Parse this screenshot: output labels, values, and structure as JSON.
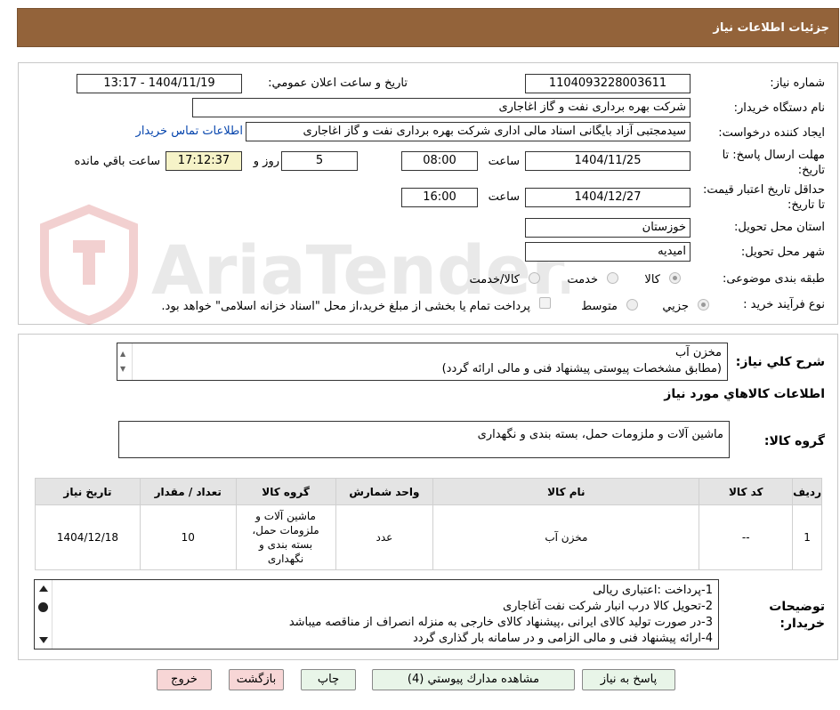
{
  "header": {
    "title": "جزئیات اطلاعات نیاز"
  },
  "watermark": {
    "text": "AriaTender.neT"
  },
  "form": {
    "need_number_label": "شماره نیاز:",
    "need_number": "1104093228003611",
    "announce_label": "تاریخ و ساعت اعلان عمومي:",
    "announce_value": "1404/11/19 - 13:17",
    "buyer_org_label": "نام دستگاه خريدار:",
    "buyer_org": "شرکت بهره برداری نفت و گاز اغاجاری",
    "requester_label": "ايجاد کننده درخواست:",
    "requester": "سیدمجتبی آزاد بایگانی اسناد مالی اداری شرکت بهره برداری نفت و گاز اغاجاری",
    "contact_link": "اطلاعات تماس خريدار",
    "deadline_label": "مهلت ارسال پاسخ: تا تاریخ:",
    "deadline_date": "1404/11/25",
    "time_label": "ساعت",
    "deadline_time": "08:00",
    "days_value": "5",
    "days_label": "روز و",
    "remaining_time": "17:12:37",
    "remaining_label": "ساعت باقي مانده",
    "validity_label": "حداقل تاريخ اعتبار قيمت: تا تاریخ:",
    "validity_date": "1404/12/27",
    "validity_time": "16:00",
    "province_label": "استان محل تحويل:",
    "province": "خوزستان",
    "city_label": "شهر محل تحويل:",
    "city": "امیدیه",
    "category_label": "طبقه بندی موضوعی:",
    "category_options": [
      "کالا",
      "خدمت",
      "کالا/خدمت"
    ],
    "process_label": "نوع فرآیند خرید :",
    "process_options": [
      "جزیي",
      "متوسط"
    ],
    "process_note": "پرداخت تمام يا بخشی از مبلغ خريد،از محل \"اسناد خزانه اسلامی\" خواهد بود."
  },
  "description": {
    "label": "شرح كلي نياز:",
    "line1": "مخزن آب",
    "line2": "(مطابق مشخصات پیوستی پیشنهاد فنی و مالی ارائه گردد)"
  },
  "goods": {
    "section_title": "اطلاعات كالاهاي مورد نياز",
    "group_label": "گروه كالا:",
    "group_value": "ماشین آلات و ملزومات حمل، بسته بندی و نگهداری"
  },
  "table": {
    "headers": [
      "رديف",
      "کد کالا",
      "نام كالا",
      "واحد شمارش",
      "گروه كالا",
      "تعداد / مقدار",
      "تاريخ نياز"
    ],
    "rows": [
      [
        "1",
        "--",
        "مخزن آب",
        "عدد",
        "ماشین آلات و ملزومات حمل، بسته بندی و نگهداری",
        "10",
        "1404/12/18"
      ]
    ]
  },
  "buyer_notes": {
    "label": "توضيحات خريدار:",
    "lines": [
      "1-پرداخت :اعتباری ریالی",
      "2-تحویل کالا درب انبار شرکت نفت آغاجاری",
      "3-در صورت تولید کالای ایرانی ،پیشنهاد کالای خارجی به منزله انصراف از مناقصه میباشد",
      "4-ارائه پیشنهاد فنی و مالی الزامی و در سامانه بار گذاری گردد"
    ]
  },
  "buttons": {
    "reply": "پاسخ به نیاز",
    "attachments": "مشاهده مدارك پيوستي (4)",
    "print": "چاپ",
    "back": "بازگشت",
    "exit": "خروج"
  },
  "colors": {
    "header_bg": "#93633a",
    "time_bg": "#f6f3c8",
    "link": "#0645ad",
    "button_green": "#e8f5e8",
    "button_red": "#f7d6d6"
  }
}
